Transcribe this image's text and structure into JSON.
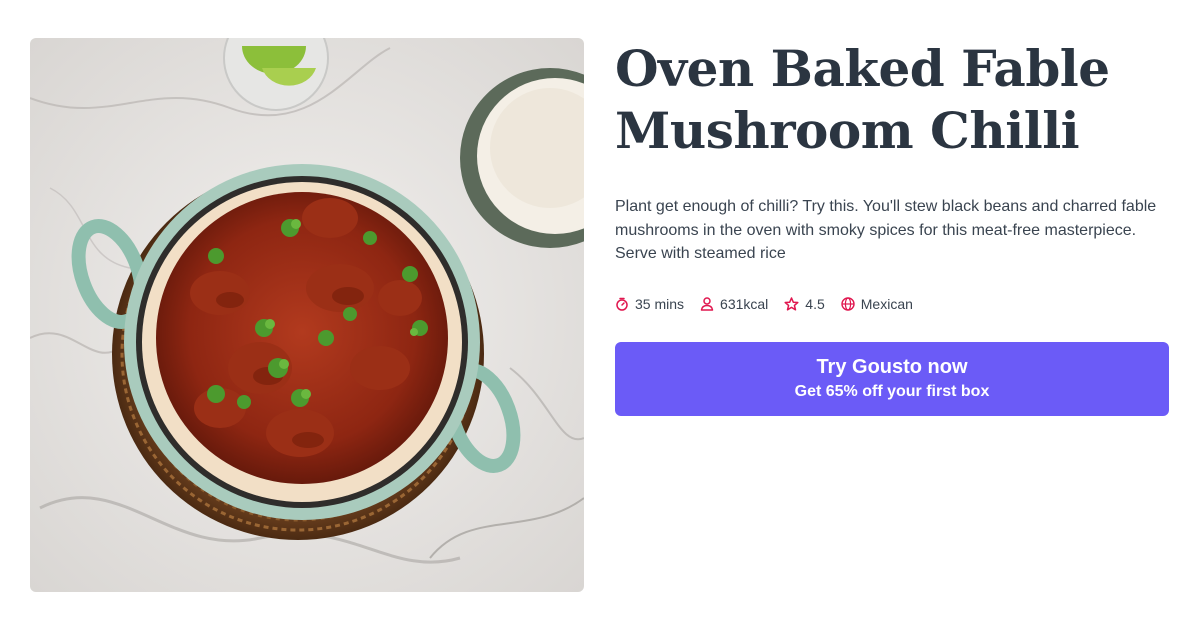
{
  "recipe": {
    "title": "Oven Baked Fable Mushroom Chilli",
    "description": "Plant get enough of chilli? Try this. You'll stew black beans and charred fable mushrooms in the oven with smoky spices for this meat-free masterpiece. Serve with steamed rice",
    "meta": {
      "time": "35 mins",
      "calories": "631kcal",
      "rating": "4.5",
      "cuisine": "Mexican"
    },
    "icons": {
      "time": "stopwatch-icon",
      "calories": "person-icon",
      "rating": "star-icon",
      "cuisine": "globe-icon"
    }
  },
  "cta": {
    "label": "Try Gousto now",
    "sublabel": "Get 65% off your first box"
  },
  "colors": {
    "accent": "#6b5bf7",
    "icon": "#e0174f",
    "title": "#2b3541",
    "text": "#3a4450"
  }
}
